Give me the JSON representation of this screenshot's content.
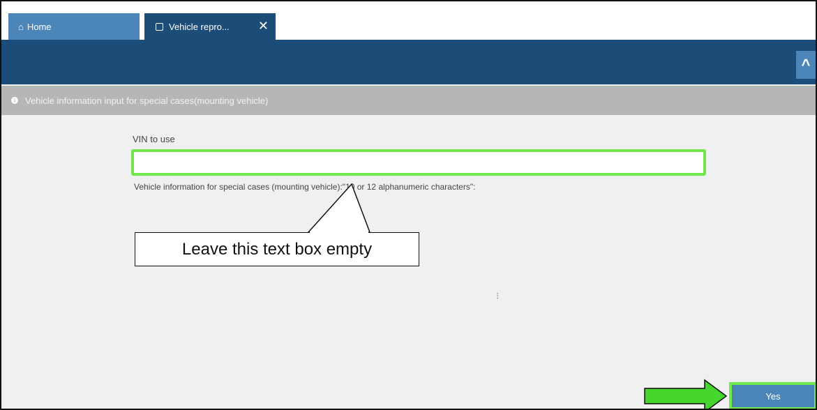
{
  "tabs": {
    "home_label": "Home",
    "active_label": "Vehicle repro...",
    "close_glyph": "✕"
  },
  "header": {
    "collapse_glyph": "^"
  },
  "info_bar": {
    "text": "Vehicle information input for special cases(mounting vehicle)"
  },
  "form": {
    "vin_label": "VIN to use",
    "vin_value": "",
    "help_text": "Vehicle information for special cases (mounting vehicle):\"10 or 12 alphanumeric characters\":"
  },
  "callout": {
    "text": "Leave this text box empty"
  },
  "footer": {
    "yes_label": "Yes"
  },
  "icons": {
    "home": "home-icon",
    "tab": "window-icon",
    "close": "close-icon",
    "collapse": "chevron-up-icon",
    "info": "info-icon",
    "spinner": "loading-icon",
    "arrow": "right-arrow-icon"
  },
  "colors": {
    "header_dark": "#1c4d78",
    "tab_light": "#4c86b8",
    "highlight_green": "#6ee84a",
    "info_bar_gray": "#b6b6b6"
  }
}
